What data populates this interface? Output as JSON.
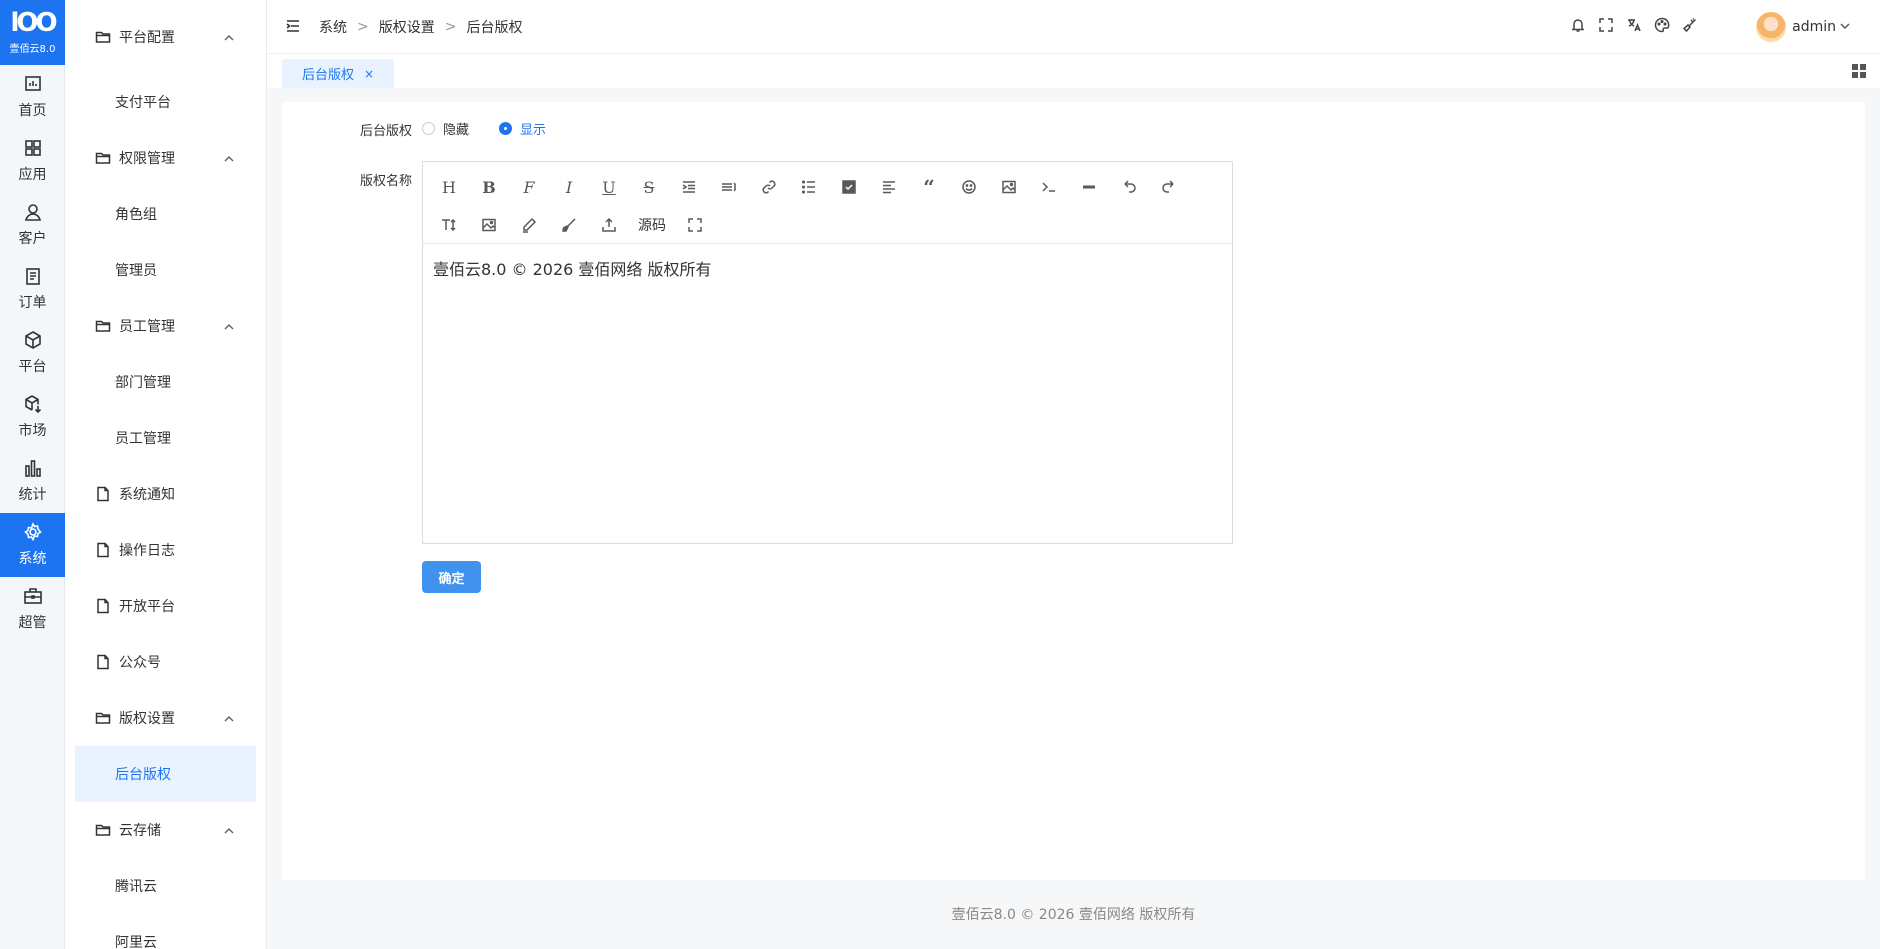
{
  "app": {
    "logo_mark": "lOO",
    "logo_version": "壹佰云8.0"
  },
  "rail": {
    "items": [
      {
        "label": "首页",
        "icon": "dashboard-icon"
      },
      {
        "label": "应用",
        "icon": "apps-icon"
      },
      {
        "label": "客户",
        "icon": "user-icon"
      },
      {
        "label": "订单",
        "icon": "clipboard-icon"
      },
      {
        "label": "平台",
        "icon": "cube-icon"
      },
      {
        "label": "市场",
        "icon": "package-download-icon"
      },
      {
        "label": "统计",
        "icon": "bar-chart-icon"
      },
      {
        "label": "系统",
        "icon": "gear-icon",
        "active": true
      },
      {
        "label": "超管",
        "icon": "briefcase-icon"
      }
    ]
  },
  "submenu": {
    "g1": "平台配置",
    "g1_items": [
      "支付平台"
    ],
    "g2": "权限管理",
    "g2_items": [
      "角色组",
      "管理员"
    ],
    "g3": "员工管理",
    "g3_items": [
      "部门管理",
      "员工管理"
    ],
    "pages": [
      "系统通知",
      "操作日志",
      "开放平台",
      "公众号"
    ],
    "g4": "版权设置",
    "g4_items": [
      "后台版权"
    ],
    "g5": "云存储",
    "g5_items": [
      "腾讯云",
      "阿里云"
    ]
  },
  "header": {
    "breadcrumb": [
      "系统",
      "版权设置",
      "后台版权"
    ],
    "breadcrumb_sep": ">",
    "username": "admin"
  },
  "tabs": [
    {
      "label": "后台版权",
      "close": "×"
    }
  ],
  "form": {
    "copyright_label": "后台版权",
    "radio_hide": "隐藏",
    "radio_show": "显示",
    "selected": "显示",
    "name_label": "版权名称",
    "source_label": "源码",
    "editor_content": "壹佰云8.0 © 2026 壹佰网络 版权所有",
    "confirm": "确定"
  },
  "footer": {
    "text": "壹佰云8.0 © 2026 壹佰网络 版权所有"
  }
}
